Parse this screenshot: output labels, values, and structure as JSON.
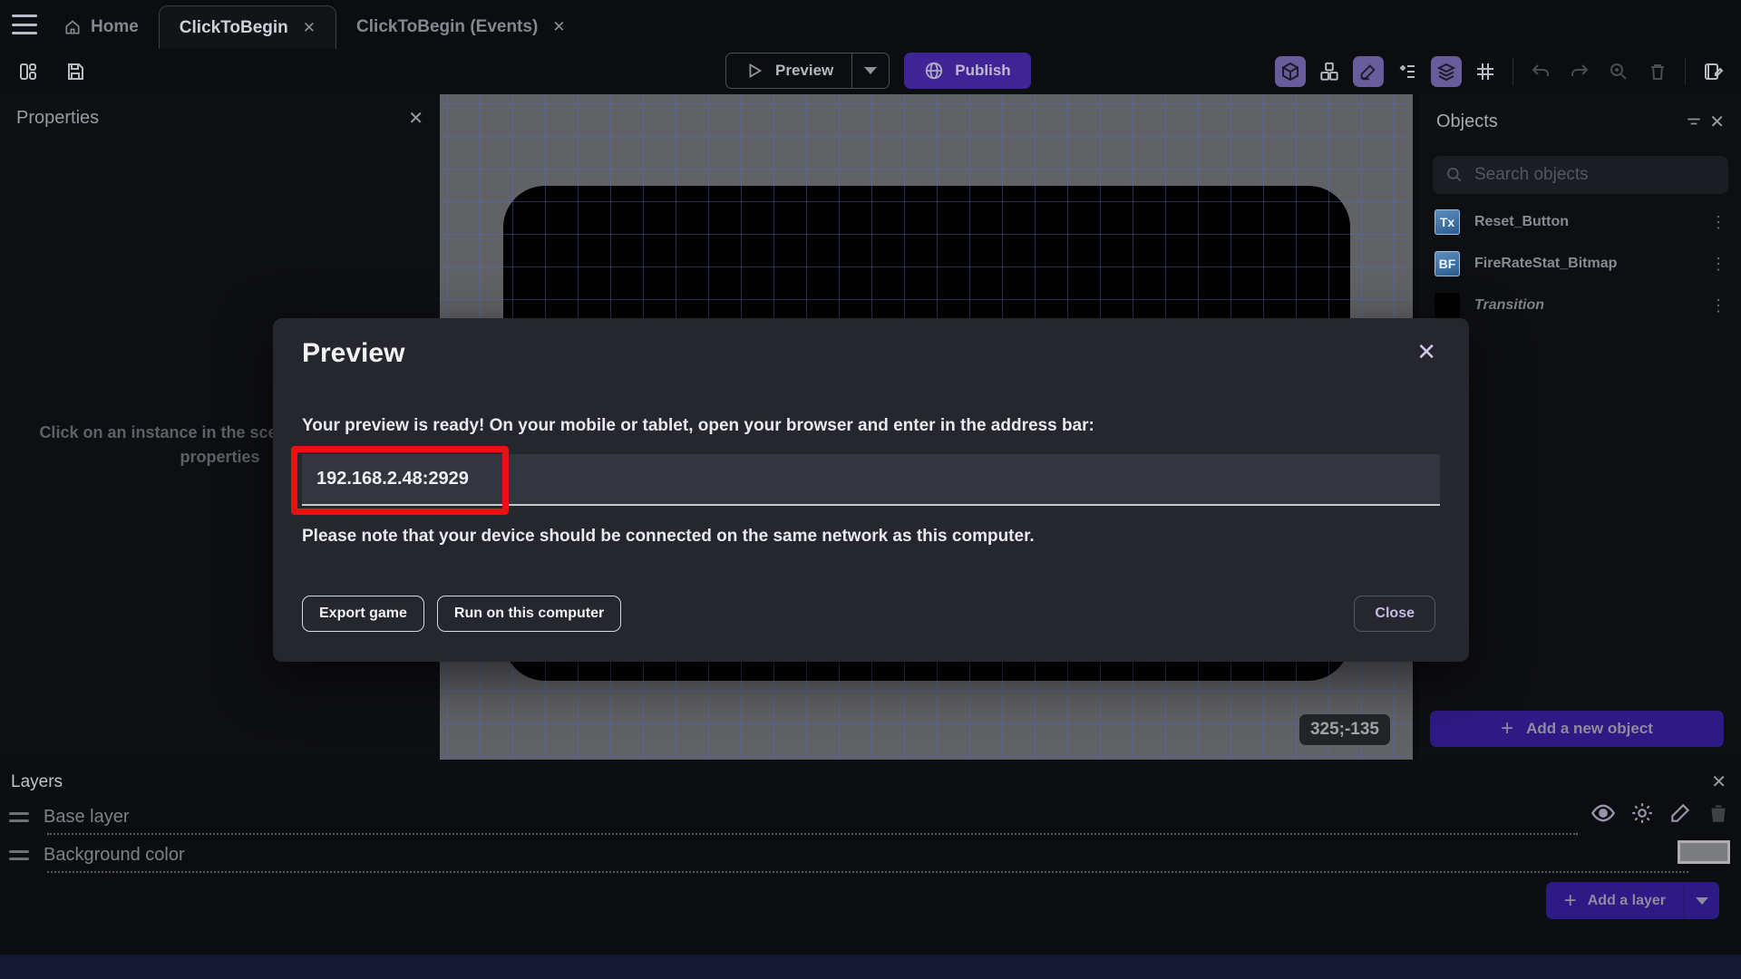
{
  "topbar": {
    "home_tab": "Home",
    "tabs": [
      {
        "label": "ClickToBegin",
        "close": "✕"
      },
      {
        "label": "ClickToBegin (Events)",
        "close": "✕"
      }
    ]
  },
  "toolbar": {
    "preview_label": "Preview",
    "publish_label": "Publish"
  },
  "properties_panel": {
    "title": "Properties",
    "close": "✕",
    "hint_line1": "Click on an instance in the scene to display its",
    "hint_line2": "properties"
  },
  "canvas": {
    "coordinates": "325;-135"
  },
  "objects_panel": {
    "title": "Objects",
    "close": "✕",
    "search_placeholder": "Search objects",
    "items": [
      {
        "name": "Reset_Button",
        "badge": "Tx"
      },
      {
        "name": "FireRateStat_Bitmap",
        "badge": "BF"
      },
      {
        "name": "Transition",
        "badge": ""
      }
    ],
    "kebab": "⋮",
    "add_button_label": "Add a new object",
    "plus": "+"
  },
  "layers_panel": {
    "title": "Layers",
    "close": "✕",
    "layers": [
      {
        "name": "Base layer"
      },
      {
        "name": "Background color"
      }
    ],
    "add_button_label": "Add a layer",
    "plus": "+"
  },
  "dialog": {
    "title": "Preview",
    "close": "✕",
    "message": "Your preview is ready! On your mobile or tablet, open your browser and enter in the address bar:",
    "address": "192.168.2.48:2929",
    "note": "Please note that your device should be connected on the same network as this computer.",
    "export_label": "Export game",
    "run_label": "Run on this computer",
    "close_label": "Close"
  },
  "colors": {
    "accent_purple": "#3f2495",
    "button_purple": "#2e1a84",
    "annotation_red": "#e91212",
    "canvas_gray": "#616266",
    "grid_blue": "#5866a0",
    "dialog_bg": "#25262e"
  }
}
